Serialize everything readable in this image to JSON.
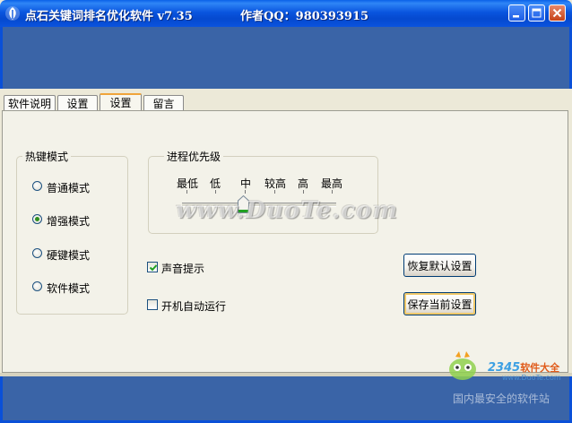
{
  "window": {
    "title": "点石关键词排名优化软件 v7.35",
    "author": "作者QQ：980393915"
  },
  "tabs": [
    {
      "label": "软件说明",
      "active": false
    },
    {
      "label": "设置",
      "active": false
    },
    {
      "label": "设置",
      "active": true
    },
    {
      "label": "留言",
      "active": false
    }
  ],
  "hotkey_group": {
    "title": "热键模式",
    "options": [
      {
        "label": "普通模式",
        "checked": false
      },
      {
        "label": "增强模式",
        "checked": true
      },
      {
        "label": "硬键模式",
        "checked": false
      },
      {
        "label": "软件模式",
        "checked": false
      }
    ]
  },
  "priority_group": {
    "title": "进程优先级",
    "levels": [
      "最低",
      "低",
      "中",
      "较高",
      "高",
      "最高"
    ],
    "selected": "中"
  },
  "options": {
    "sound_label": "声音提示",
    "sound_checked": true,
    "autorun_label": "开机自动运行",
    "autorun_checked": false
  },
  "buttons": {
    "restore_defaults": "恢复默认设置",
    "save_settings": "保存当前设置"
  },
  "watermark": {
    "text": "www.DuoTe.com"
  },
  "brand": {
    "number": "2345",
    "name": "软件大全",
    "url": "www.DuoTe.com",
    "slogan": "国内最安全的软件站"
  },
  "colors": {
    "titlebar": "#0a55df",
    "band": "#3a64a7",
    "panel": "#f3f2e9",
    "radio_dot": "#2f8f1f"
  }
}
